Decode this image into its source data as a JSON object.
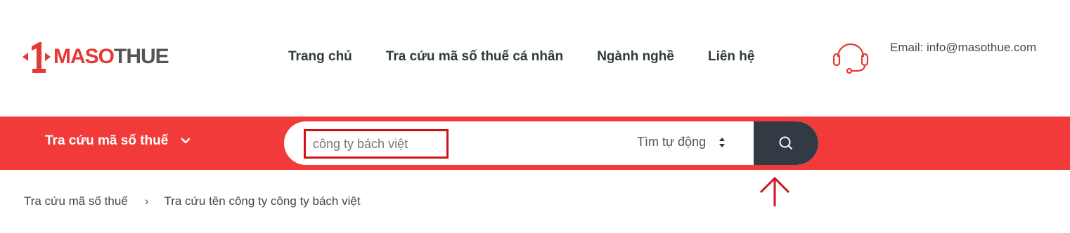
{
  "brand": {
    "logo_part_red": "MASO",
    "logo_part_gray": "THUE",
    "logo_mark_digit": "1"
  },
  "nav": {
    "items": [
      {
        "label": "Trang chủ"
      },
      {
        "label": "Tra cứu mã số thuế cá nhân"
      },
      {
        "label": "Ngành nghề"
      },
      {
        "label": "Liên hệ"
      }
    ]
  },
  "contact": {
    "icon": "headset-icon",
    "email_text": "Email: info@masothue.com"
  },
  "search": {
    "category_label": "Tra cứu mã số thuế",
    "query_value": "công ty bách việt",
    "mode_label": "Tìm tự động",
    "button_icon": "search-icon"
  },
  "breadcrumb": {
    "items": [
      {
        "label": "Tra cứu mã số thuế"
      },
      {
        "label": "Tra cứu tên công ty công ty bách việt"
      }
    ],
    "separator": "›"
  },
  "colors": {
    "brand_red": "#f23a3a",
    "highlight_red": "#d0131b",
    "dark_button": "#323b44"
  }
}
